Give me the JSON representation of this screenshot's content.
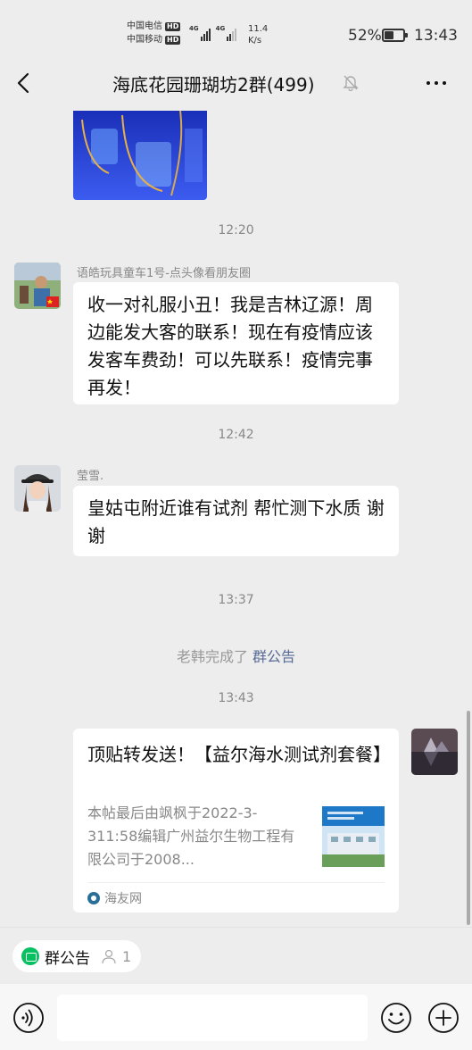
{
  "status_bar": {
    "carrier_1": "中国电信",
    "carrier_2": "中国移动",
    "hd_badge": "HD",
    "network_1": "4G",
    "network_2": "4G",
    "speed_value": "11.4",
    "speed_unit": "K/s",
    "battery_percent": "52%",
    "battery_level": 0.52,
    "time": "13:43"
  },
  "nav": {
    "title": "海底花园珊瑚坊2群(499)",
    "back_icon": "back-chevron-icon",
    "mute_icon": "mute-bell-icon",
    "more_icon": "more-dots-icon"
  },
  "messages": {
    "ts_1": "12:20",
    "msg1_sender": "语皓玩具童车1号-点头像看朋友圈",
    "msg1_text": "收一对礼服小丑！我是吉林辽源！周边能发大客的联系！现在有疫情应该发客车费劲！可以先联系！疫情完事再发！",
    "ts_2": "12:42",
    "msg2_sender": "莹雪.",
    "msg2_text": "皇姑屯附近谁有试剂 帮忙测下水质 谢谢",
    "ts_3": "13:37",
    "system_prefix": "老韩完成了",
    "system_link": "群公告",
    "ts_4": "13:43",
    "card_title": "顶贴转发送！【益尔海水测试剂套餐】",
    "card_desc": "本帖最后由飒枫于2022-3-311:58编辑广州益尔生物工程有限公司于2008...",
    "card_source": "海友网"
  },
  "pinned": {
    "label": "群公告",
    "count": "1"
  },
  "input": {
    "placeholder": ""
  },
  "colors": {
    "accent_green": "#07c160",
    "link_blue": "#576b95",
    "background": "#ededed"
  }
}
